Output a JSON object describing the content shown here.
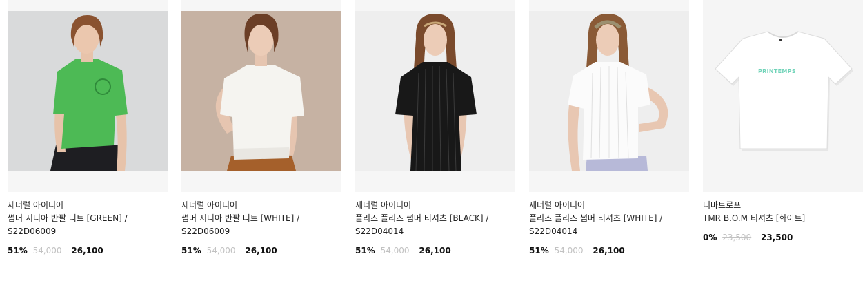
{
  "products": [
    {
      "brand": "제너럴 아이디어",
      "name": "썸머 지니아 반팔 니트 [GREEN] / S22D06009",
      "discount": "51%",
      "original_price": "54,000",
      "sale_price": "26,100",
      "image": "green-knit-model-photo",
      "bg_color": "#d9dadb",
      "garment_color": "#4dba55"
    },
    {
      "brand": "제너럴 아이디어",
      "name": "썸머 지니아 반팔 니트 [WHITE] / S22D06009",
      "discount": "51%",
      "original_price": "54,000",
      "sale_price": "26,100",
      "image": "white-knit-model-photo",
      "bg_color": "#c6b2a3",
      "garment_color": "#f5f4f0"
    },
    {
      "brand": "제너럴 아이디어",
      "name": "플리즈 플리즈 썸머 티셔츠 [BLACK] / S22D04014",
      "discount": "51%",
      "original_price": "54,000",
      "sale_price": "26,100",
      "image": "black-pleated-tee-model-photo",
      "bg_color": "#eeeeee",
      "garment_color": "#181818"
    },
    {
      "brand": "제너럴 아이디어",
      "name": "플리즈 플리즈 썸머 티셔츠 [WHITE] / S22D04014",
      "discount": "51%",
      "original_price": "54,000",
      "sale_price": "26,100",
      "image": "white-pleated-tee-model-photo",
      "bg_color": "#eeeeee",
      "garment_color": "#fbfbfb"
    },
    {
      "brand": "더마트로프",
      "name": "TMR B.O.M 티셔츠 [화이트]",
      "discount": "0%",
      "original_price": "23,500",
      "sale_price": "23,500",
      "image": "white-tee-flatlay-photo",
      "bg_color": "#f5f5f5",
      "garment_color": "#ffffff",
      "print_text": "PRINTEMPS"
    }
  ]
}
